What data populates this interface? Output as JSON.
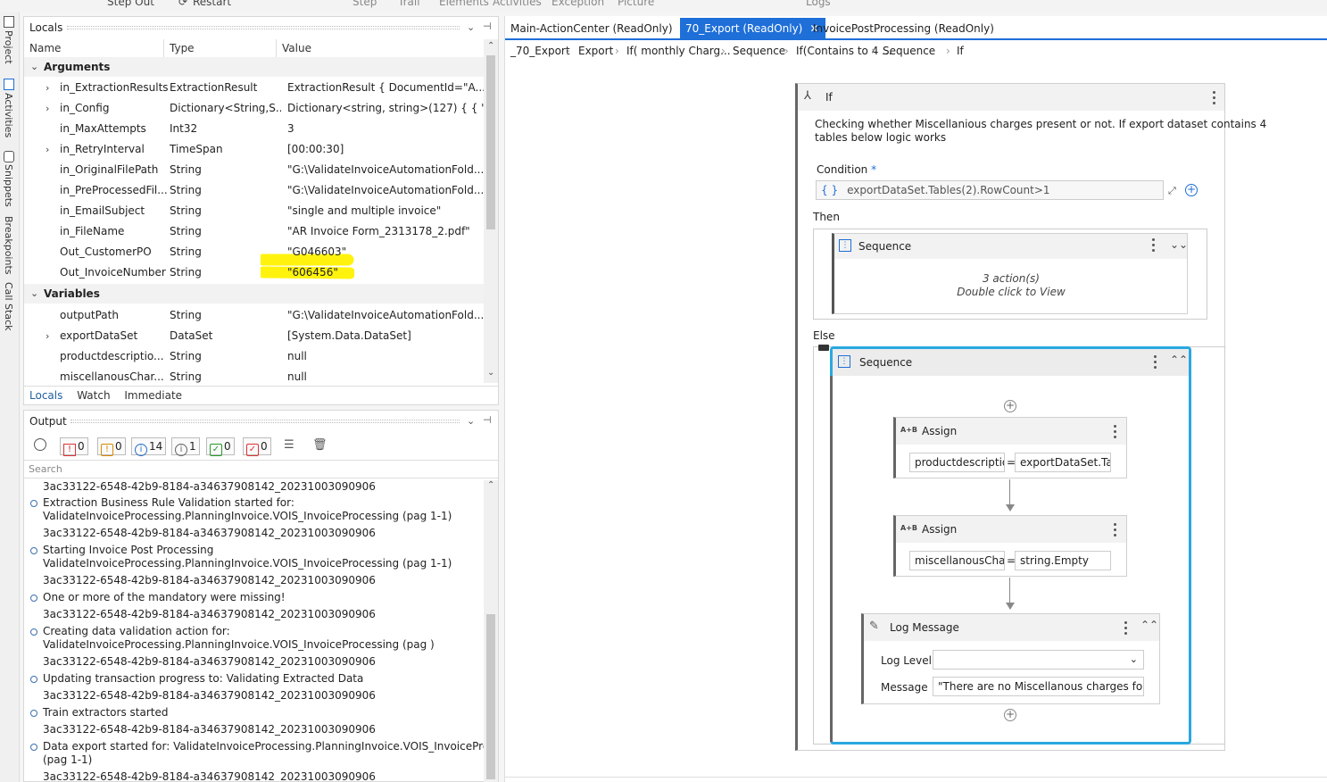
{
  "toolbar": {
    "step_out": "Step Out",
    "restart": "Restart",
    "clipped_labels": [
      "Step",
      "Trail",
      "Elements",
      "Activities",
      "Exception",
      "Picture",
      "Logs"
    ]
  },
  "side_tabs": [
    "Project",
    "Activities",
    "Snippets",
    "Breakpoints",
    "Call Stack"
  ],
  "locals": {
    "title": "Locals",
    "columns": [
      "Name",
      "Type",
      "Value"
    ],
    "arguments_label": "Arguments",
    "arguments": [
      {
        "name": "in_ExtractionResults",
        "type": "ExtractionResult",
        "value": "ExtractionResult { DocumentId=\"A..."
      },
      {
        "name": "in_Config",
        "type": "Dictionary<String,S...",
        "value": "Dictionary<string, string>(127) { { \"I..."
      },
      {
        "name": "in_MaxAttempts",
        "type": "Int32",
        "value": "3"
      },
      {
        "name": "in_RetryInterval",
        "type": "TimeSpan",
        "value": "[00:00:30]"
      },
      {
        "name": "in_OriginalFilePath",
        "type": "String",
        "value": "\"G:\\ValidateInvoiceAutomationFold..."
      },
      {
        "name": "in_PreProcessedFil...",
        "type": "String",
        "value": "\"G:\\ValidateInvoiceAutomationFold..."
      },
      {
        "name": "in_EmailSubject",
        "type": "String",
        "value": "\"single and multiple invoice\""
      },
      {
        "name": "in_FileName",
        "type": "String",
        "value": "\"AR Invoice Form_2313178_2.pdf\""
      },
      {
        "name": "Out_CustomerPO",
        "type": "String",
        "value": "\"G046603\""
      },
      {
        "name": "Out_InvoiceNumber",
        "type": "String",
        "value": "\"606456\""
      }
    ],
    "variables_label": "Variables",
    "variables": [
      {
        "name": "outputPath",
        "type": "String",
        "value": "\"G:\\ValidateInvoiceAutomationFold..."
      },
      {
        "name": "exportDataSet",
        "type": "DataSet",
        "value": "[System.Data.DataSet]"
      },
      {
        "name": "productdescriptio...",
        "type": "String",
        "value": "null"
      },
      {
        "name": "miscellanousChar...",
        "type": "String",
        "value": "null"
      }
    ],
    "bottom_tabs": [
      "Locals",
      "Watch",
      "Immediate"
    ]
  },
  "output": {
    "title": "Output",
    "counts": {
      "error": "0",
      "warning": "0",
      "info": "14",
      "trace": "1",
      "success": "0",
      "failed": "0"
    },
    "search_placeholder": "Search",
    "lines": [
      {
        "icon": false,
        "text": "3ac33122-6548-42b9-8184-a34637908142_20231003090906"
      },
      {
        "icon": true,
        "text": "Extraction Business Rule Validation started for:"
      },
      {
        "icon": false,
        "text": "ValidateInvoiceProcessing.PlanningInvoice.VOIS_InvoiceProcessing (pag 1-1)"
      },
      {
        "icon": false,
        "text": "3ac33122-6548-42b9-8184-a34637908142_20231003090906"
      },
      {
        "icon": true,
        "text": "Starting Invoice Post Processing"
      },
      {
        "icon": false,
        "text": "ValidateInvoiceProcessing.PlanningInvoice.VOIS_InvoiceProcessing (pag 1-1)"
      },
      {
        "icon": false,
        "text": "3ac33122-6548-42b9-8184-a34637908142_20231003090906"
      },
      {
        "icon": true,
        "text": "One or more of the mandatory were missing!"
      },
      {
        "icon": false,
        "text": "3ac33122-6548-42b9-8184-a34637908142_20231003090906"
      },
      {
        "icon": true,
        "text": "Creating data validation action for:"
      },
      {
        "icon": false,
        "text": "ValidateInvoiceProcessing.PlanningInvoice.VOIS_InvoiceProcessing (pag )"
      },
      {
        "icon": false,
        "text": "3ac33122-6548-42b9-8184-a34637908142_20231003090906"
      },
      {
        "icon": true,
        "text": "Updating transaction progress to: Validating Extracted Data"
      },
      {
        "icon": false,
        "text": "3ac33122-6548-42b9-8184-a34637908142_20231003090906"
      },
      {
        "icon": true,
        "text": "Train extractors started"
      },
      {
        "icon": false,
        "text": "3ac33122-6548-42b9-8184-a34637908142_20231003090906"
      },
      {
        "icon": true,
        "text": "Data export started for: ValidateInvoiceProcessing.PlanningInvoice.VOIS_InvoiceProcessing"
      },
      {
        "icon": false,
        "text": "(pag 1-1)"
      },
      {
        "icon": false,
        "text": "3ac33122-6548-42b9-8184-a34637908142_20231003090906"
      }
    ]
  },
  "designer": {
    "tabs": [
      "Main-ActionCenter (ReadOnly)",
      "70_Export (ReadOnly)",
      "InvoicePostProcessing (ReadOnly)"
    ],
    "breadcrumb": [
      "_70_Export",
      "Export",
      "If( monthly Charg...",
      "Sequence",
      "If(Contains to 4 ...",
      "Sequence",
      "If"
    ],
    "if_activity": {
      "title": "If",
      "annotation_line1": "Checking whether Miscellanious charges present or not. If export dataset contains 4",
      "annotation_line2": "tables below logic works",
      "condition_label": "Condition",
      "required_mark": "*",
      "condition_braces": "{ }",
      "condition_value": "exportDataSet.Tables(2).RowCount>1",
      "then_label": "Then",
      "else_label": "Else"
    },
    "then_sequence": {
      "title": "Sequence",
      "actions": "3 action(s)",
      "hint": "Double click to View"
    },
    "else_sequence": {
      "title": "Sequence"
    },
    "assign1": {
      "title": "Assign",
      "to": "productdescription",
      "eq": "=",
      "value": "exportDataSet.Tabl"
    },
    "assign2": {
      "title": "Assign",
      "to": "miscellanousCharges",
      "eq": "=",
      "value": "string.Empty"
    },
    "log_message": {
      "title": "Log Message",
      "level_label": "Log Level",
      "level_value": "",
      "message_label": "Message",
      "message_value": "\"There are no Miscellanous charges for this"
    },
    "assign_badge": "A+B"
  },
  "colors": {
    "accent": "#1e6fd8",
    "highlight": "#fff200",
    "selection": "#29a8e0"
  }
}
